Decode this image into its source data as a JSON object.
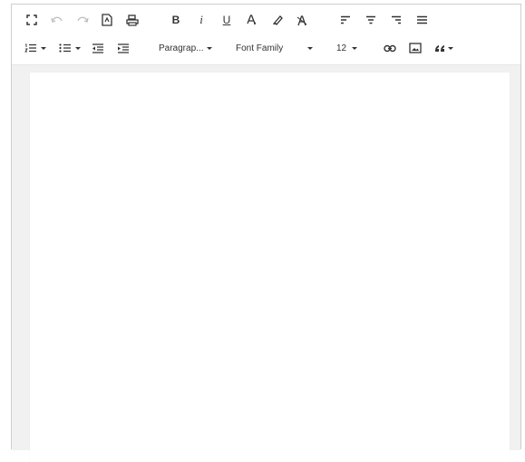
{
  "toolbar": {
    "row1": {
      "fullscreen": "fullscreen-icon",
      "undo": "undo-icon",
      "redo": "redo-icon",
      "preview": "preview-document-icon",
      "print": "print-icon",
      "bold_label": "B",
      "italic_label": "i",
      "underline_label": "U",
      "font_color": "font-color-icon",
      "highlight": "highlighter-icon",
      "clear_format": "clear-format-icon",
      "align_left": "align-left-icon",
      "align_center": "align-center-icon",
      "align_right": "align-right-icon",
      "align_justify": "align-justify-icon"
    },
    "row2": {
      "ordered_list": "ordered-list-icon",
      "unordered_list": "unordered-list-icon",
      "outdent": "outdent-icon",
      "indent": "indent-icon",
      "paragraph_value": "Paragrap...",
      "font_family_value": "Font Family",
      "font_size_value": "12",
      "link": "link-icon",
      "image": "image-icon",
      "blockquote": "blockquote-icon"
    },
    "disabled_color": "#bdbdbd",
    "icon_color": "#333333"
  },
  "editor": {
    "content": ""
  }
}
